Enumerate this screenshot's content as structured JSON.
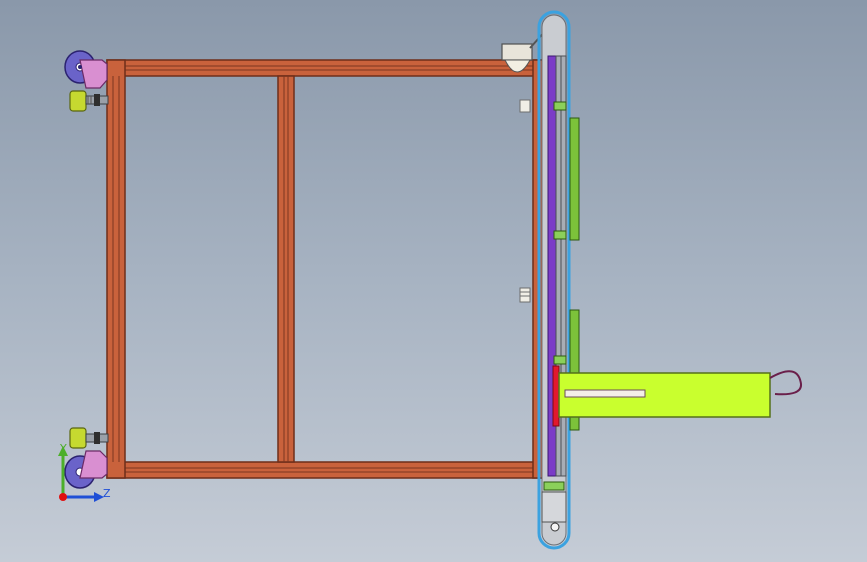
{
  "triad": {
    "y_label": "Y",
    "z_label": "Z",
    "y_color": "#4caf2a",
    "z_color": "#1f4fd6",
    "x_color": "#e01010"
  },
  "colors": {
    "frame_outer": "#7a3520",
    "frame_fill": "#c9623c",
    "purple_rail": "#7b3cc7",
    "lime_body": "#c9ff2e",
    "green_rail": "#7cc23a",
    "caster": "#d98fd1",
    "wheel": "#6a63c9",
    "leveling_foot": "#c6d930",
    "red_plate": "#e2182e",
    "belt": "#3ba2e0"
  }
}
